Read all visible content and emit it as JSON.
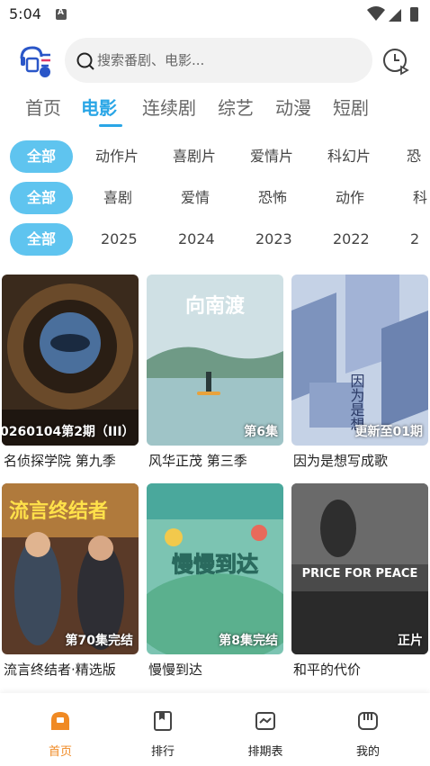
{
  "status": {
    "time": "5:04"
  },
  "search": {
    "placeholder": "搜索番剧、电影..."
  },
  "main_tabs": [
    {
      "label": "首页",
      "active": false
    },
    {
      "label": "电影",
      "active": true
    },
    {
      "label": "连续剧",
      "active": false
    },
    {
      "label": "综艺",
      "active": false
    },
    {
      "label": "动漫",
      "active": false
    },
    {
      "label": "短剧",
      "active": false
    }
  ],
  "filters": {
    "type": [
      "全部",
      "动作片",
      "喜剧片",
      "爱情片",
      "科幻片",
      "恐"
    ],
    "genre": [
      "全部",
      "喜剧",
      "爱情",
      "恐怖",
      "动作",
      "科"
    ],
    "year": [
      "全部",
      "2025",
      "2024",
      "2023",
      "2022",
      "2"
    ]
  },
  "cards": [
    {
      "title": "名侦探学院 第九季",
      "badge": "0260104第2期（III）"
    },
    {
      "title": "风华正茂 第三季",
      "badge": "第6集",
      "poster_text": "向南渡"
    },
    {
      "title": "因为是想写成歌",
      "badge": "更新至01期"
    },
    {
      "title": "流言终结者·精选版",
      "badge": "第70集完结",
      "poster_text": "流言终结者"
    },
    {
      "title": "慢慢到达",
      "badge": "第8集完结",
      "poster_text": "慢慢到达"
    },
    {
      "title": "和平的代价",
      "badge": "正片",
      "poster_text": "PRICE FOR PEACE"
    }
  ],
  "bottom_nav": [
    {
      "label": "首页",
      "icon": "home-icon",
      "active": true
    },
    {
      "label": "排行",
      "icon": "ranking-icon",
      "active": false
    },
    {
      "label": "排期表",
      "icon": "schedule-icon",
      "active": false
    },
    {
      "label": "我的",
      "icon": "profile-icon",
      "active": false
    }
  ],
  "colors": {
    "accent": "#2aa6e6",
    "chip_active": "#5fc4ef",
    "nav_active": "#f08a24"
  }
}
